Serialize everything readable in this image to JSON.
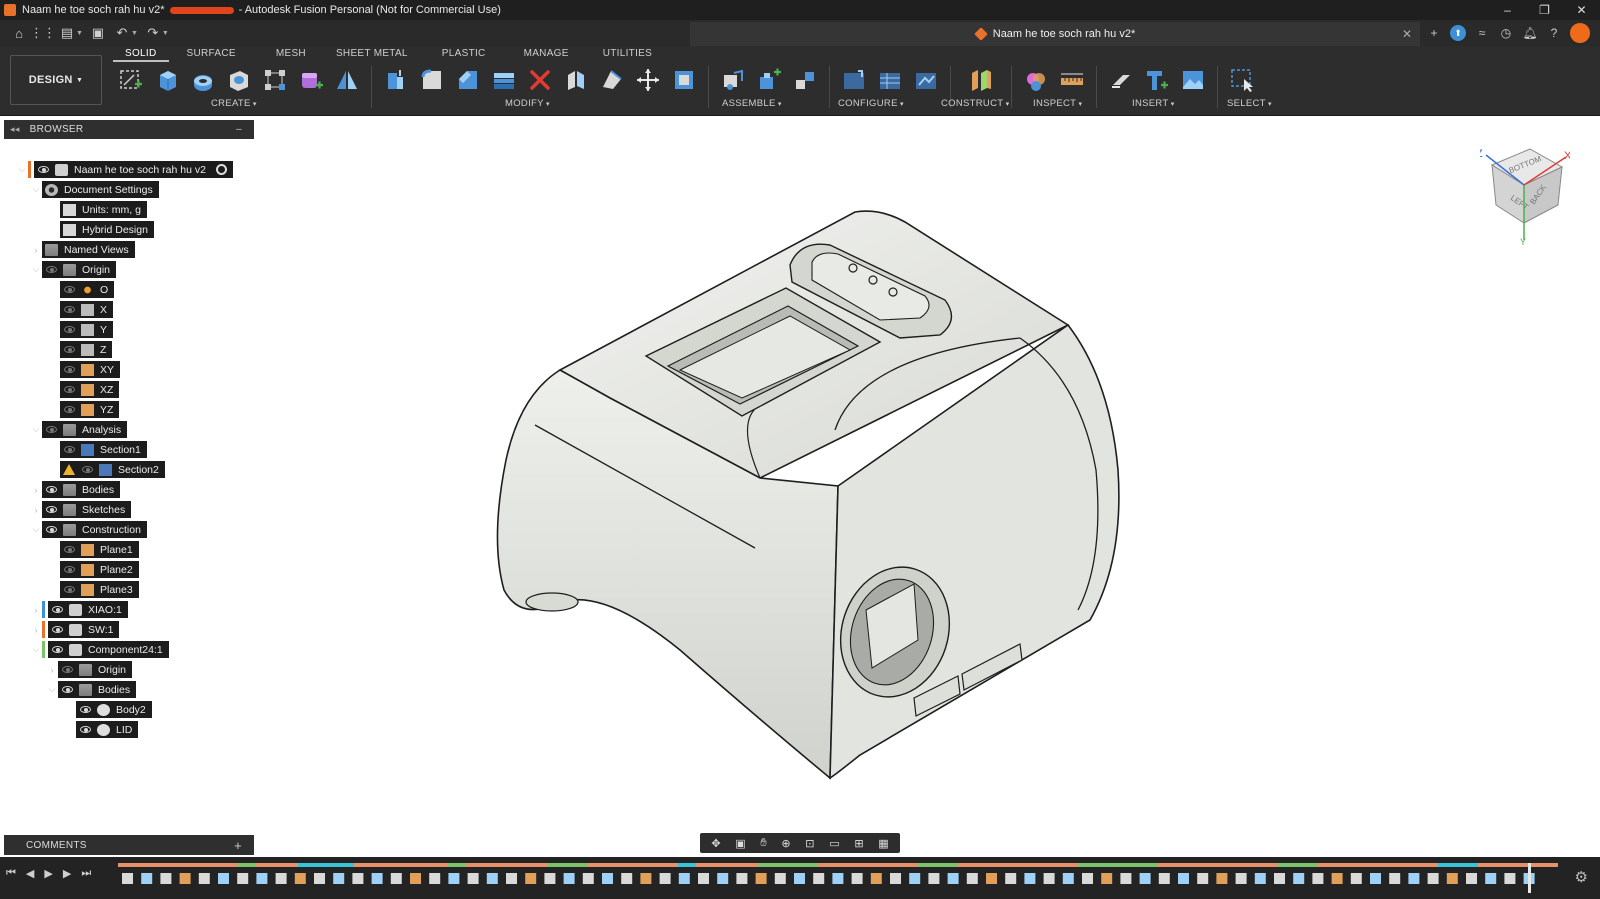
{
  "window": {
    "title_prefix": "Naam he toe soch rah hu v2*",
    "title_suffix": "- Autodesk Fusion Personal (Not for Commercial Use)",
    "controls": [
      "–",
      "❐",
      "✕"
    ]
  },
  "document_tab": {
    "title": "Naam he toe soch rah hu v2*"
  },
  "workspace": {
    "label": "DESIGN"
  },
  "ribbon": {
    "tabs": [
      "SOLID",
      "SURFACE",
      "MESH",
      "SHEET METAL",
      "PLASTIC",
      "MANAGE",
      "UTILITIES"
    ],
    "active_tab": "SOLID",
    "groups": {
      "create": "CREATE",
      "modify": "MODIFY",
      "assemble": "ASSEMBLE",
      "configure": "CONFIGURE",
      "construct": "CONSTRUCT",
      "inspect": "INSPECT",
      "insert": "INSERT",
      "select": "SELECT"
    }
  },
  "browser": {
    "title": "BROWSER",
    "nodes": [
      {
        "label": "Naam he toe soch rah hu v2",
        "icon": "component-icon"
      },
      {
        "label": "Document Settings",
        "icon": "gear-icon"
      },
      {
        "label": "Units: mm, g",
        "icon": "document-icon"
      },
      {
        "label": "Hybrid Design",
        "icon": "document-icon"
      },
      {
        "label": "Named Views",
        "icon": "folder-icon"
      },
      {
        "label": "Origin",
        "icon": "folder-icon"
      },
      {
        "label": "O",
        "icon": "point-icon"
      },
      {
        "label": "X",
        "icon": "axis-icon"
      },
      {
        "label": "Y",
        "icon": "axis-icon"
      },
      {
        "label": "Z",
        "icon": "axis-icon"
      },
      {
        "label": "XY",
        "icon": "plane-icon"
      },
      {
        "label": "XZ",
        "icon": "plane-icon"
      },
      {
        "label": "YZ",
        "icon": "plane-icon"
      },
      {
        "label": "Analysis",
        "icon": "folder-icon"
      },
      {
        "label": "Section1",
        "icon": "section-icon"
      },
      {
        "label": "Section2",
        "icon": "section-icon"
      },
      {
        "label": "Bodies",
        "icon": "folder-icon"
      },
      {
        "label": "Sketches",
        "icon": "folder-icon"
      },
      {
        "label": "Construction",
        "icon": "folder-icon"
      },
      {
        "label": "Plane1",
        "icon": "plane-icon"
      },
      {
        "label": "Plane2",
        "icon": "plane-icon"
      },
      {
        "label": "Plane3",
        "icon": "plane-icon"
      },
      {
        "label": "XIAO:1",
        "icon": "component-icon"
      },
      {
        "label": "SW:1",
        "icon": "component-icon"
      },
      {
        "label": "Component24:1",
        "icon": "component-icon"
      },
      {
        "label": "Origin",
        "icon": "folder-icon"
      },
      {
        "label": "Bodies",
        "icon": "folder-icon"
      },
      {
        "label": "Body2",
        "icon": "body-icon"
      },
      {
        "label": "LID",
        "icon": "body-icon"
      }
    ]
  },
  "comments": {
    "title": "COMMENTS"
  },
  "viewcube": {
    "faces": [
      "BOTTOM",
      "LEFT",
      "BACK"
    ],
    "axes": [
      "Z",
      "X",
      "Y"
    ]
  },
  "colors": {
    "accent_orange": "#e8722c",
    "ribbon_bg": "#2d2d2d",
    "model_fill": "#e4e6e2"
  }
}
